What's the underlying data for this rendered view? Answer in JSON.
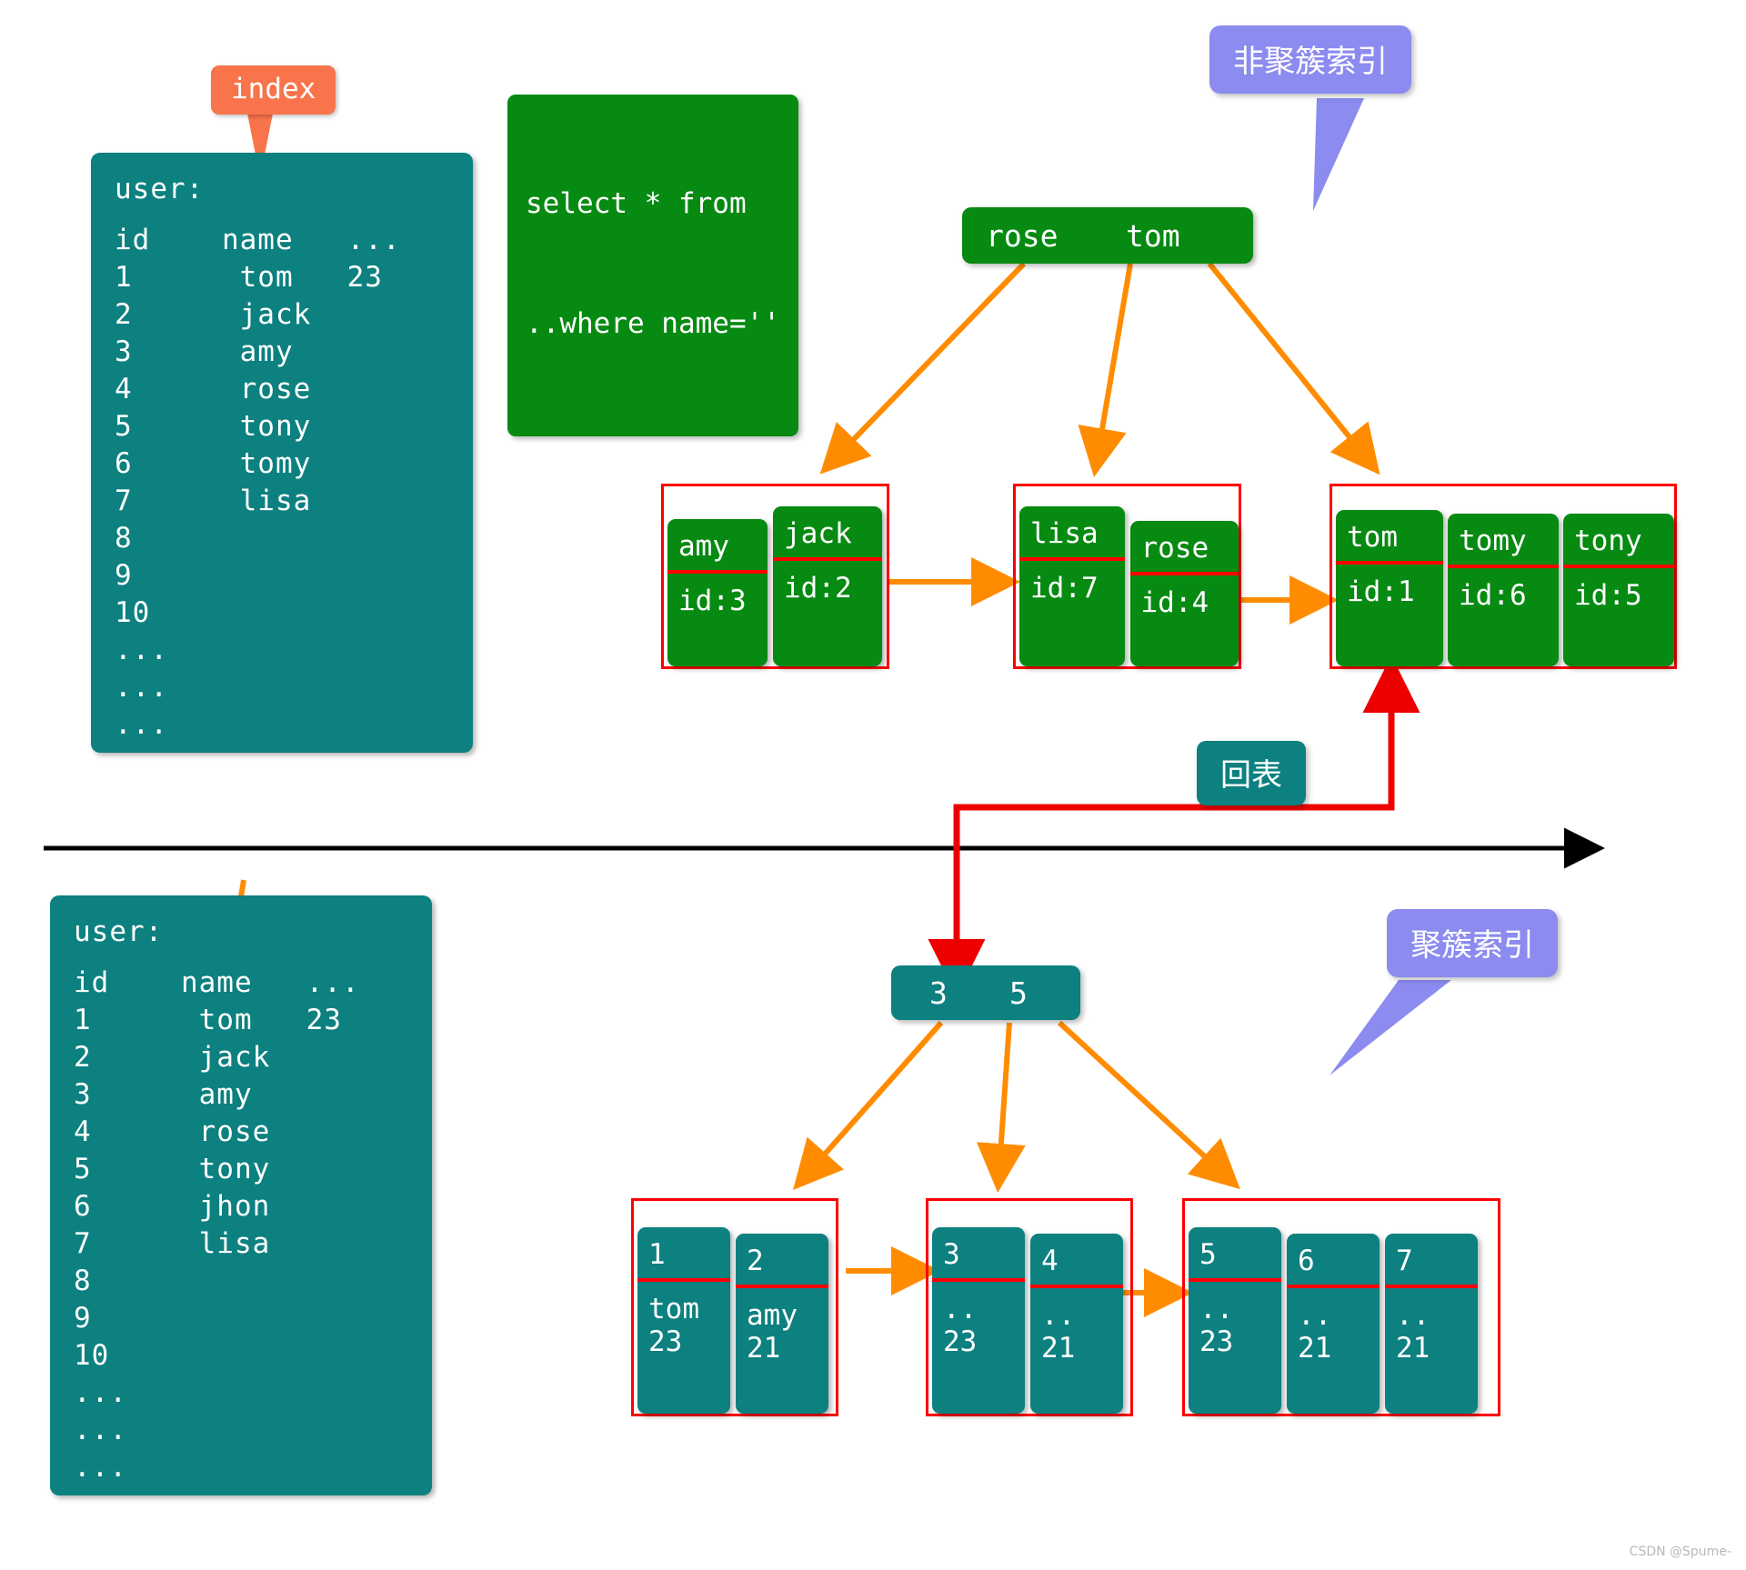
{
  "colors": {
    "teal": "#0d8080",
    "green": "#078a12",
    "orange": "#f9744b",
    "arrow_orange": "#ff8c00",
    "red": "#ff0000",
    "purple": "#8b8bf0",
    "black": "#000000"
  },
  "callouts": {
    "index_label": "index",
    "sql_line1": "select * from",
    "sql_line2": "..where name=''",
    "nonclustered_label": "非聚簇索引",
    "clustered_label": "聚簇索引",
    "back_to_table_label": "回表"
  },
  "top_table": {
    "title": "user:",
    "header": "id    name   ...",
    "rows": [
      "1      tom   23",
      "2      jack",
      "3      amy",
      "4      rose",
      "5      tony",
      "6      tomy",
      "7      lisa",
      "8",
      "9",
      "10",
      "...",
      "...",
      "..."
    ]
  },
  "bottom_table": {
    "title": "user:",
    "header": "id    name   ...",
    "rows": [
      "1      tom   23",
      "2      jack",
      "3      amy",
      "4      rose",
      "5      tony",
      "6      jhon",
      "7      lisa",
      "8",
      "9",
      "10",
      "...",
      "...",
      "..."
    ]
  },
  "nonclustered_index": {
    "root_keys": [
      "rose",
      "tom"
    ],
    "leaf_groups": [
      {
        "cells": [
          {
            "top": "amy",
            "bottom": "id:3"
          },
          {
            "top": "jack",
            "bottom": "id:2"
          }
        ]
      },
      {
        "cells": [
          {
            "top": "lisa",
            "bottom": "id:7"
          },
          {
            "top": "rose",
            "bottom": "id:4"
          }
        ]
      },
      {
        "cells": [
          {
            "top": "tom",
            "bottom": "id:1"
          },
          {
            "top": "tomy",
            "bottom": "id:6"
          },
          {
            "top": "tony",
            "bottom": "id:5"
          }
        ]
      }
    ]
  },
  "clustered_index": {
    "root_keys": [
      "3",
      "5"
    ],
    "leaf_groups": [
      {
        "cells": [
          {
            "top": "1",
            "bottom": "tom\n23"
          },
          {
            "top": "2",
            "bottom": "amy\n21"
          }
        ]
      },
      {
        "cells": [
          {
            "top": "3",
            "bottom": "..\n23"
          },
          {
            "top": "4",
            "bottom": "..\n21"
          }
        ]
      },
      {
        "cells": [
          {
            "top": "5",
            "bottom": "..\n23"
          },
          {
            "top": "6",
            "bottom": "..\n21"
          },
          {
            "top": "7",
            "bottom": "..\n21"
          }
        ]
      }
    ]
  },
  "watermark": "CSDN @Spume-"
}
